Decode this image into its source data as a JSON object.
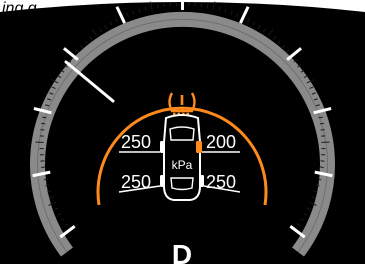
{
  "header_partial_text": "ing g",
  "tpms": {
    "unit": "kPa",
    "front_left": "250",
    "front_right": "200",
    "rear_left": "250",
    "rear_right": "250",
    "alert_color": "#ff8a1c"
  },
  "gear": {
    "value": "D"
  },
  "needle_color": "#ffffff",
  "gauge_colors": {
    "ring": "#8a8a8a",
    "background": "#000000"
  }
}
